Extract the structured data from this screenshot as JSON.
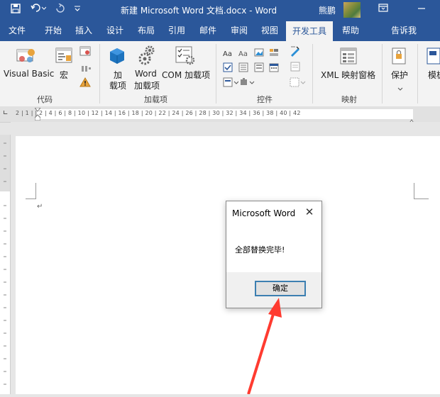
{
  "titlebar": {
    "title": "新建 Microsoft Word 文档.docx - Word",
    "user": "熊鹏",
    "save_icon": "save-icon",
    "undo_icon": "undo-icon",
    "redo_icon": "redo-icon",
    "customize_icon": "customize-qat-icon"
  },
  "tabs": [
    {
      "label": "文件"
    },
    {
      "label": "开始"
    },
    {
      "label": "插入"
    },
    {
      "label": "设计"
    },
    {
      "label": "布局"
    },
    {
      "label": "引用"
    },
    {
      "label": "邮件"
    },
    {
      "label": "审阅"
    },
    {
      "label": "视图"
    },
    {
      "label": "开发工具"
    },
    {
      "label": "帮助"
    },
    {
      "label": "告诉我"
    }
  ],
  "ribbon": {
    "code": {
      "visual_basic": "Visual Basic",
      "macro": "宏",
      "label": "代码"
    },
    "addins": {
      "addins_line1": "加",
      "addins_line2": "载项",
      "word_line1": "Word",
      "word_line2": "加载项",
      "com": "COM 加载项",
      "label": "加载项"
    },
    "controls": {
      "label": "控件"
    },
    "mapping": {
      "xml": "XML 映射窗格",
      "label": "映射"
    },
    "protect": {
      "protect": "保护"
    },
    "template": {
      "label": "模板"
    }
  },
  "ruler": {
    "text": "2 | 1 |    | 2 |  4 |  6 |  8 | 10 | 12 | 14 | 16 | 18 | 20 | 22 | 24 | 26 | 28 | 30 | 32 | 34 | 36 | 38 | 40 | 42"
  },
  "dialog": {
    "title": "Microsoft Word",
    "message": "全部替换完毕!",
    "ok": "确定"
  },
  "colors": {
    "accent": "#2b579a",
    "arrow": "#ff3b30"
  }
}
